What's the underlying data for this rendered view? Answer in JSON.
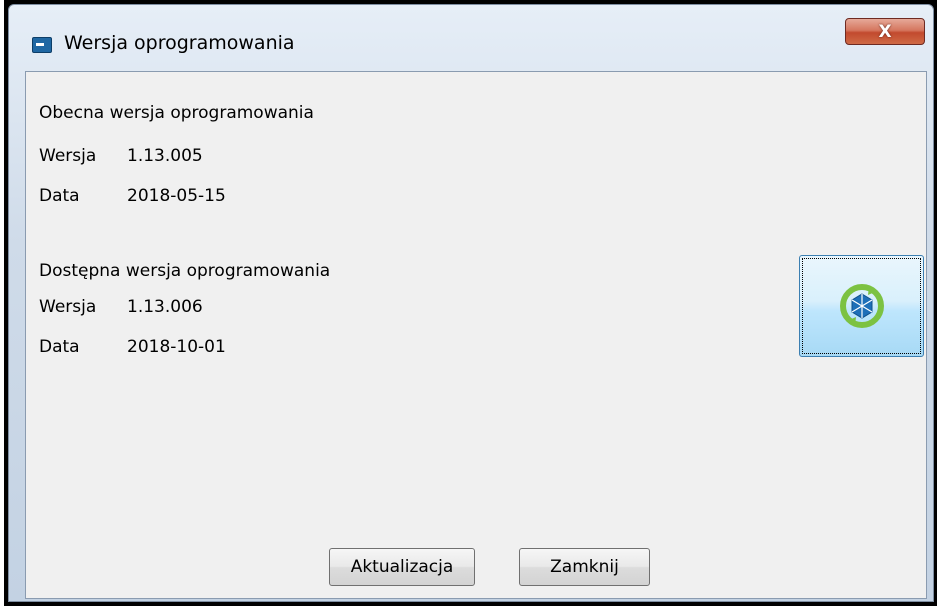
{
  "window": {
    "title": "Wersja oprogramowania",
    "close_label": "X"
  },
  "current": {
    "heading": "Obecna wersja oprogramowania",
    "version_label": "Wersja",
    "version_value": "1.13.005",
    "date_label": "Data",
    "date_value": "2018-05-15"
  },
  "available": {
    "heading": "Dostępna wersja oprogramowania",
    "version_label": "Wersja",
    "version_value": "1.13.006",
    "date_label": "Data",
    "date_value": "2018-10-01"
  },
  "buttons": {
    "update_label": "Aktualizacja",
    "close_label": "Zamknij"
  },
  "icons": {
    "update": "sync-update-icon",
    "app": "app-icon"
  },
  "colors": {
    "close_button": "#c24a2e",
    "update_ring_green": "#7cc242",
    "update_core_blue": "#1e6fb8"
  }
}
